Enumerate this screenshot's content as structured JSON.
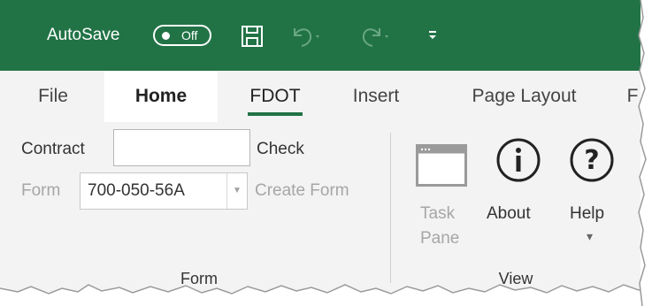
{
  "titlebar": {
    "autosave_label": "AutoSave",
    "toggle_state": "Off",
    "icons": [
      "save-icon",
      "undo-icon",
      "redo-icon",
      "customize-qat-icon"
    ]
  },
  "tabs": [
    {
      "label": "File"
    },
    {
      "label": "Home"
    },
    {
      "label": "FDOT"
    },
    {
      "label": "Insert"
    },
    {
      "label": "Page Layout"
    },
    {
      "label": "F"
    }
  ],
  "ribbon": {
    "form_group": {
      "contract_label": "Contract",
      "contract_value": "",
      "check_label": "Check",
      "form_label": "Form",
      "form_value": "700-050-56A",
      "create_form_label": "Create Form",
      "group_label": "Form"
    },
    "view_group": {
      "task_pane_line1": "Task",
      "task_pane_line2": "Pane",
      "about_label": "About",
      "help_label": "Help",
      "help_arrow": "▾",
      "group_label": "View"
    }
  },
  "colors": {
    "accent": "#217346",
    "ribbon_bg": "#f3f3f3",
    "disabled_text": "#a6a6a6"
  }
}
